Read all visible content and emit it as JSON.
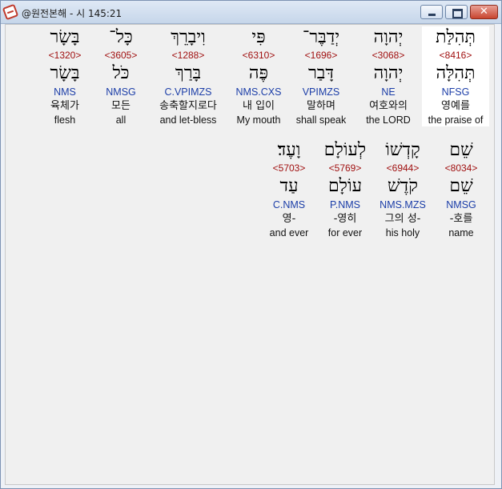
{
  "window": {
    "title": "@원전본해 - 시 145:21"
  },
  "lines": [
    {
      "words": [
        {
          "hebrew": "תְּהִלַּת",
          "strong": "<8416>",
          "lemma": "תְּהִלָּה",
          "morph": "NFSG",
          "korean": "영예를",
          "english": "the praise of",
          "highlighted": true
        },
        {
          "hebrew": "יְהוָה",
          "strong": "<3068>",
          "lemma": "יְהוָה",
          "morph": "NE",
          "korean": "여호와의",
          "english": "the LORD",
          "highlighted": false
        },
        {
          "hebrew": "יְדַבֶּר־",
          "strong": "<1696>",
          "lemma": "דָּבַר",
          "morph": "VPIMZS",
          "korean": "말하며",
          "english": "shall speak",
          "highlighted": false
        },
        {
          "hebrew": "פִּי",
          "strong": "<6310>",
          "lemma": "פֶּה",
          "morph": "NMS.CXS",
          "korean": "내 입이",
          "english": "My mouth",
          "highlighted": false
        },
        {
          "hebrew": "וִיבָרֵךְ",
          "strong": "<1288>",
          "lemma": "בָּרַךְ",
          "morph": "C.VPIMZS",
          "korean": "송축할지로다",
          "english": "and let-bless",
          "highlighted": false
        },
        {
          "hebrew": "כָּל־",
          "strong": "<3605>",
          "lemma": "כֹּל",
          "morph": "NMSG",
          "korean": "모든",
          "english": "all",
          "highlighted": false
        },
        {
          "hebrew": "בָּשָׂר",
          "strong": "<1320>",
          "lemma": "בָּשָׂר",
          "morph": "NMS",
          "korean": "육체가",
          "english": "flesh",
          "highlighted": false
        }
      ]
    },
    {
      "words": [
        {
          "hebrew": "שֵׁם",
          "strong": "<8034>",
          "lemma": "שֵׁם",
          "morph": "NMSG",
          "korean": "-호를",
          "english": "name",
          "highlighted": false
        },
        {
          "hebrew": "קָדְשׁוֹ",
          "strong": "<6944>",
          "lemma": "קֹדֶשׁ",
          "morph": "NMS.MZS",
          "korean": "그의 성-",
          "english": "his holy",
          "highlighted": false
        },
        {
          "hebrew": "לְעוֹלָם",
          "strong": "<5769>",
          "lemma": "עוֹלָם",
          "morph": "P.NMS",
          "korean": "-영히",
          "english": "for ever",
          "highlighted": false
        },
        {
          "hebrew": "וָעֶד׃",
          "strong": "<5703>",
          "lemma": "עַד",
          "morph": "C.NMS",
          "korean": "영-",
          "english": "and ever",
          "highlighted": false
        }
      ]
    }
  ]
}
